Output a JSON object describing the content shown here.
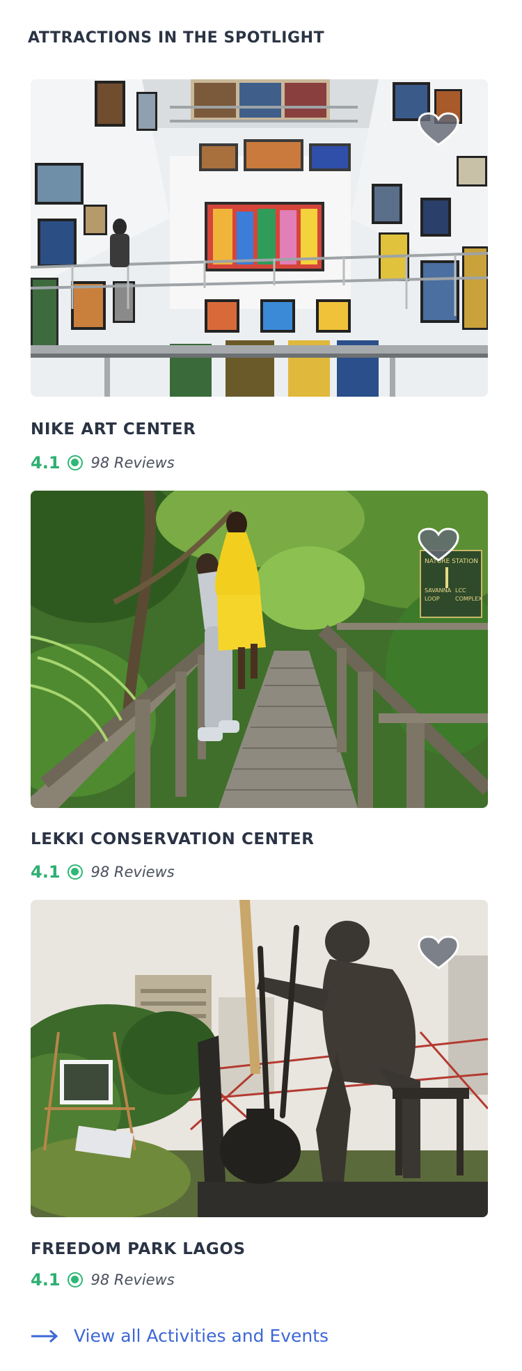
{
  "section": {
    "title": "ATTRACTIONS IN THE SPOTLIGHT"
  },
  "attractions": [
    {
      "name": "NIKE ART CENTER",
      "rating": "4.1",
      "reviews": "98 Reviews",
      "favorite_icon": "heart-icon"
    },
    {
      "name": "LEKKI CONSERVATION CENTER",
      "rating": "4.1",
      "reviews": "98 Reviews",
      "favorite_icon": "heart-icon",
      "sign": {
        "line1": "NATURE STATION",
        "line2": "SAVANNA",
        "line3": "LOOP",
        "line4": "LCC",
        "line5": "COMPLEX"
      }
    },
    {
      "name": "FREEDOM PARK LAGOS",
      "rating": "4.1",
      "reviews": "98 Reviews",
      "favorite_icon": "heart-icon"
    }
  ],
  "footer": {
    "view_all_label": "View all Activities and Events",
    "icon": "arrow-right-icon"
  },
  "colors": {
    "heading": "#2b3445",
    "rating_green": "#2eaf73",
    "link_blue": "#3d67d6"
  }
}
